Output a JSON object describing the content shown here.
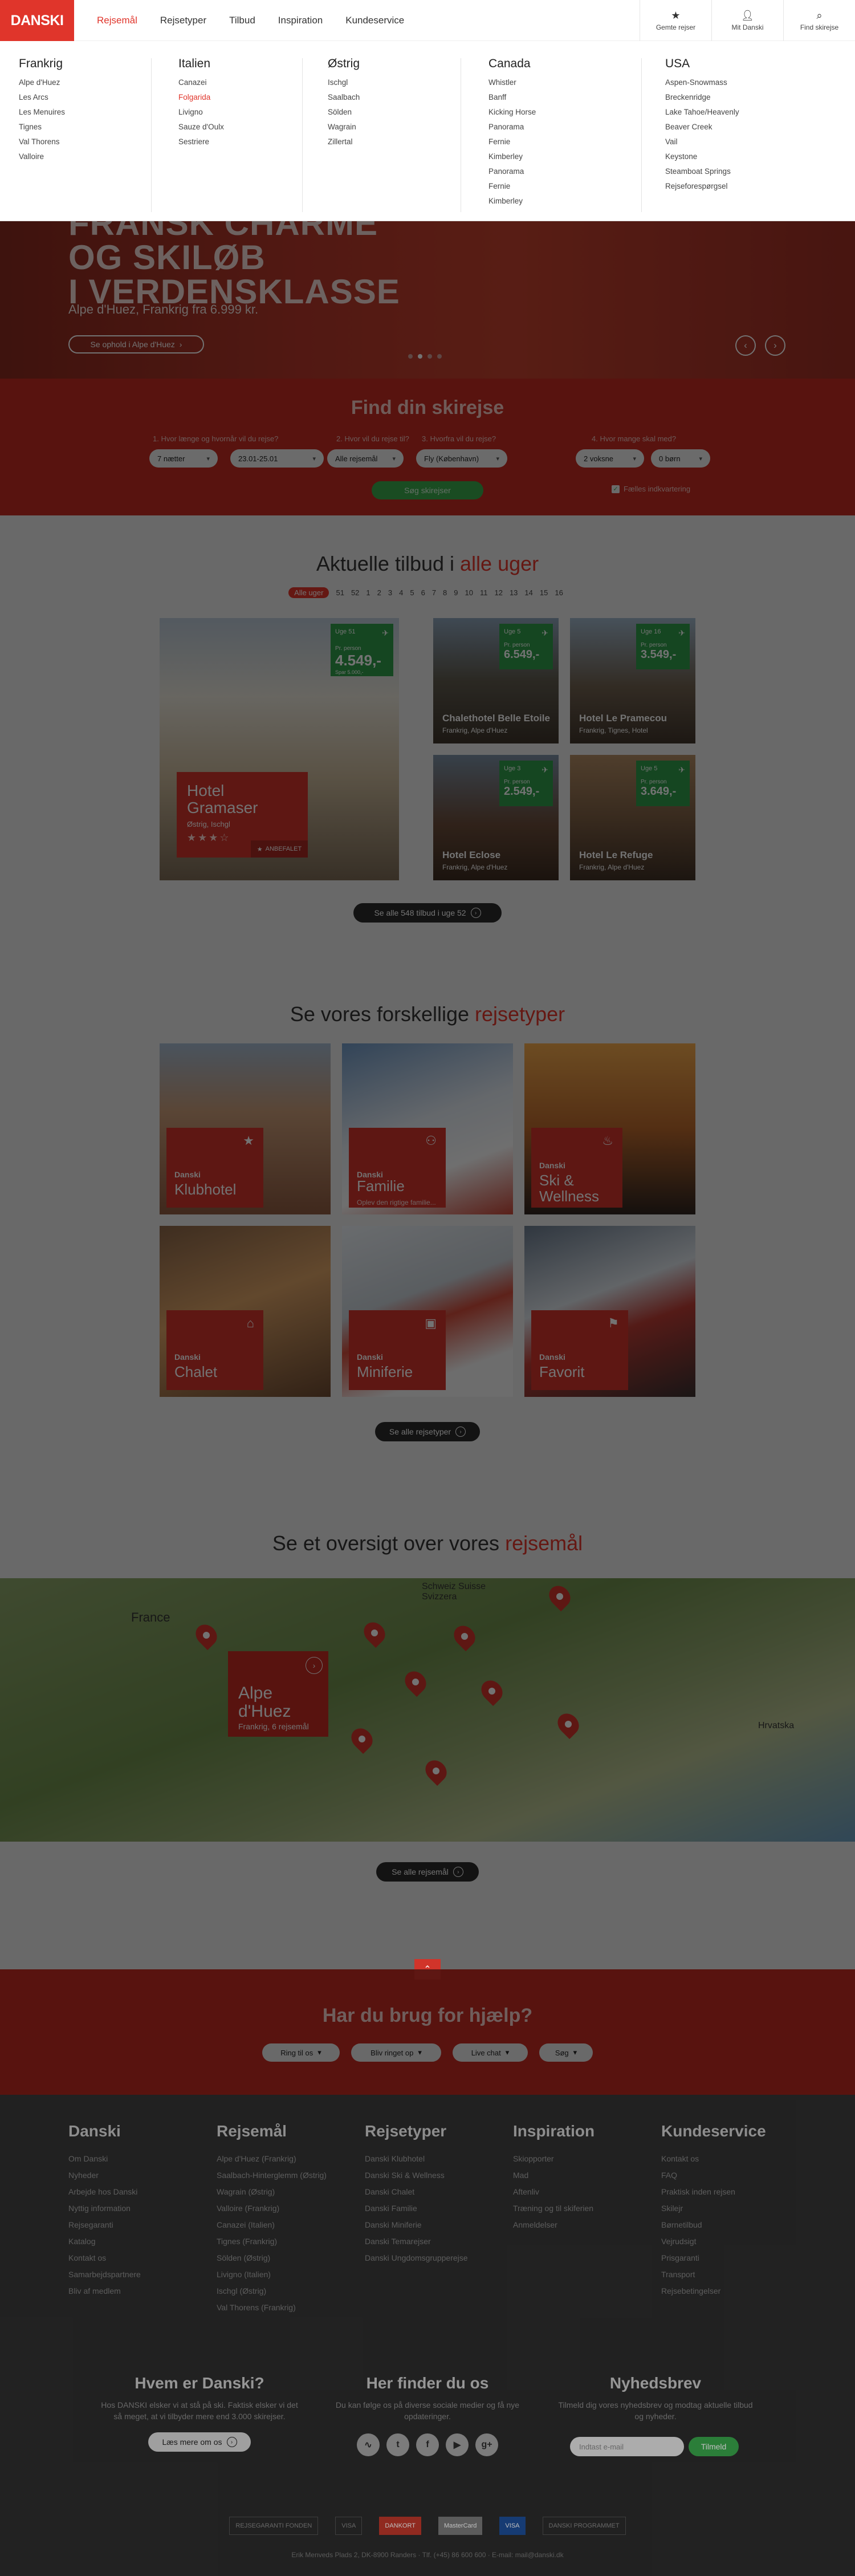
{
  "brand": "DANSKI",
  "nav": {
    "items": [
      "Rejsemål",
      "Rejsetyper",
      "Tilbud",
      "Inspiration",
      "Kundeservice"
    ],
    "active": "Rejsemål",
    "tools": [
      {
        "label": "Gemte rejser",
        "icon": "star-icon"
      },
      {
        "label": "Mit Danski",
        "icon": "user-icon"
      },
      {
        "label": "Find skirejse",
        "icon": "search-icon"
      }
    ]
  },
  "mega": {
    "columns": [
      {
        "title": "Frankrig",
        "items": [
          "Alpe d'Huez",
          "Les Arcs",
          "Les Menuires",
          "Tignes",
          "Val Thorens",
          "Valloire"
        ]
      },
      {
        "title": "Italien",
        "items": [
          "Canazei",
          "Folgarida",
          "Livigno",
          "Sauze d'Oulx",
          "Sestriere"
        ],
        "highlight": "Folgarida"
      },
      {
        "title": "Østrig",
        "items": [
          "Ischgl",
          "Saalbach",
          "Sölden",
          "Wagrain",
          "Zillertal"
        ]
      },
      {
        "title": "Canada",
        "items": [
          "Whistler",
          "Banff",
          "Kicking Horse",
          "Panorama",
          "Fernie",
          "Kimberley",
          "Panorama",
          "Fernie",
          "Kimberley"
        ]
      },
      {
        "title": "USA",
        "items": [
          "Aspen-Snowmass",
          "Breckenridge",
          "Lake Tahoe/Heavenly",
          "Beaver Creek",
          "Vail",
          "Keystone",
          "Steamboat Springs",
          "Rejseforespørgsel"
        ]
      }
    ]
  },
  "hero": {
    "line1": "FRANSK CHARME",
    "line2": "OG SKILØB",
    "line3": "I VERDENSKLASSE",
    "sub": "Alpe d'Huez, Frankrig fra 6.999 kr.",
    "cta": "Se ophold i Alpe d'Huez"
  },
  "search": {
    "title": "Find din skirejse",
    "labels": [
      "1. Hvor længe og hvornår vil du rejse?",
      "2. Hvor vil du rejse til?",
      "3. Hvorfra vil du rejse?",
      "4. Hvor mange skal med?"
    ],
    "fields": [
      "7 nætter",
      "23.01-25.01",
      "Alle rejsemål",
      "Fly (København)",
      "2 voksne",
      "0 børn"
    ],
    "button": "Søg skirejser",
    "checkbox": "Fælles indkvartering"
  },
  "offers": {
    "title": "Aktuelle tilbud i",
    "title_em": "alle uger",
    "weeks": [
      "Alle uger",
      "51",
      "52",
      "1",
      "2",
      "3",
      "4",
      "5",
      "6",
      "7",
      "8",
      "9",
      "10",
      "11",
      "12",
      "13",
      "14",
      "15",
      "16"
    ],
    "cards": [
      {
        "name": "Hotel Gramaser",
        "loc": "Østrig, Ischgl",
        "week": "Uge 51",
        "price": "4.549,-"
      },
      {
        "name": "Chalethotel Belle Etoile",
        "loc": "Frankrig, Alpe d'Huez",
        "week": "Uge 5",
        "price": "6.549,-"
      },
      {
        "name": "Hotel Le Pramecou",
        "loc": "Frankrig, Tignes, Hotel",
        "week": "Uge 16",
        "price": "3.549,-"
      },
      {
        "name": "Hotel Eclose",
        "loc": "Frankrig, Alpe d'Huez",
        "week": "Uge 3",
        "price": "2.549,-"
      },
      {
        "name": "Hotel Le Refuge",
        "loc": "Frankrig, Alpe d'Huez",
        "week": "Uge 5",
        "price": "3.649,-"
      }
    ],
    "per_person": "Pr. person",
    "from_text": "Spar 5.000,-",
    "recommended": "ANBEFALET",
    "all_btn": "Se alle 548 tilbud i uge 52"
  },
  "types": {
    "title": "Se vores forskellige",
    "title_em": "rejsetyper",
    "brand": "Danski",
    "items": [
      {
        "name": "Klubhotel",
        "sub": "",
        "icon": "star-icon"
      },
      {
        "name": "Familie",
        "sub": "Oplev den rigtige familie...",
        "icon": "family-icon"
      },
      {
        "name": "Ski & Wellness",
        "sub": "",
        "icon": "wellness-icon"
      },
      {
        "name": "Chalet",
        "sub": "",
        "icon": "house-icon"
      },
      {
        "name": "Miniferie",
        "sub": "",
        "icon": "suitcase-icon"
      },
      {
        "name": "Favorit",
        "sub": "",
        "icon": "flag-icon"
      }
    ],
    "all_btn": "Se alle rejsetyper"
  },
  "dest": {
    "title": "Se et oversigt over vores",
    "title_em": "rejsemål",
    "map_labels": [
      "France",
      "Schweiz Suisse Svizzera",
      "Hrvatska"
    ],
    "card": {
      "name": "Alpe d'Huez",
      "loc": "Frankrig, 6 rejsemål"
    },
    "all_btn": "Se alle rejsemål"
  },
  "help": {
    "title": "Har du brug for hjælp?",
    "buttons": [
      "Ring til os",
      "Bliv ringet op",
      "Live chat",
      "Søg"
    ]
  },
  "footer": {
    "cols": [
      {
        "title": "Danski",
        "items": [
          "Om Danski",
          "Nyheder",
          "Arbejde hos Danski",
          "Nyttig information",
          "Rejsegaranti",
          "Katalog",
          "Kontakt os",
          "Samarbejdspartnere",
          "Bliv af medlem"
        ]
      },
      {
        "title": "Rejsemål",
        "items": [
          "Alpe d'Huez (Frankrig)",
          "Saalbach-Hinterglemm (Østrig)",
          "Wagrain (Østrig)",
          "Valloire (Frankrig)",
          "Canazei (Italien)",
          "Tignes (Frankrig)",
          "Sölden (Østrig)",
          "Livigno (Italien)",
          "Ischgl (Østrig)",
          "Val Thorens (Frankrig)"
        ]
      },
      {
        "title": "Rejsetyper",
        "items": [
          "Danski Klubhotel",
          "Danski Ski & Wellness",
          "Danski Chalet",
          "Danski Familie",
          "Danski Miniferie",
          "Danski Temarejser",
          "Danski Ungdomsgrupperejse"
        ]
      },
      {
        "title": "Inspiration",
        "items": [
          "Skiopporter",
          "Mad",
          "Aftenliv",
          "Træning og til skiferien",
          "Anmeldelser"
        ]
      },
      {
        "title": "Kundeservice",
        "items": [
          "Kontakt os",
          "FAQ",
          "Praktisk inden rejsen",
          "Skilejr",
          "Børnetilbud",
          "Vejrudsigt",
          "Prisgaranti",
          "Transport",
          "Rejsebetingelser"
        ]
      }
    ],
    "about": {
      "title": "Hvem er Danski?",
      "text": "Hos DANSKI elsker vi at stå på ski. Faktisk elsker vi det så meget, at vi tilbyder mere end 3.000 skirejser.",
      "btn": "Læs mere om os"
    },
    "social": {
      "title": "Her finder du os",
      "text": "Du kan følge os på diverse sociale medier og få nye opdateringer.",
      "icons": [
        "rss-icon",
        "twitter-icon",
        "facebook-icon",
        "youtube-icon",
        "googleplus-icon"
      ],
      "glyphs": [
        "∿",
        "t",
        "f",
        "▶",
        "g+"
      ]
    },
    "news": {
      "title": "Nyhedsbrev",
      "text": "Tilmeld dig vores nyhedsbrev og modtag aktuelle tilbud og nyheder.",
      "placeholder": "Indtast e-mail",
      "btn": "Tilmeld"
    },
    "logos": [
      "REJSEGARANTI FONDEN",
      "VISA",
      "DANKORT",
      "MasterCard",
      "VISA",
      "DANSKI PROGRAMMET"
    ],
    "address": "Erik Menveds Plads 2, DK-8900 Randers · Tlf. (+45) 86 600 600 · E-mail: mail@danski.dk"
  },
  "colors": {
    "accent": "#e0352b",
    "green": "#3aa84d",
    "dark": "#2d2d2d"
  }
}
